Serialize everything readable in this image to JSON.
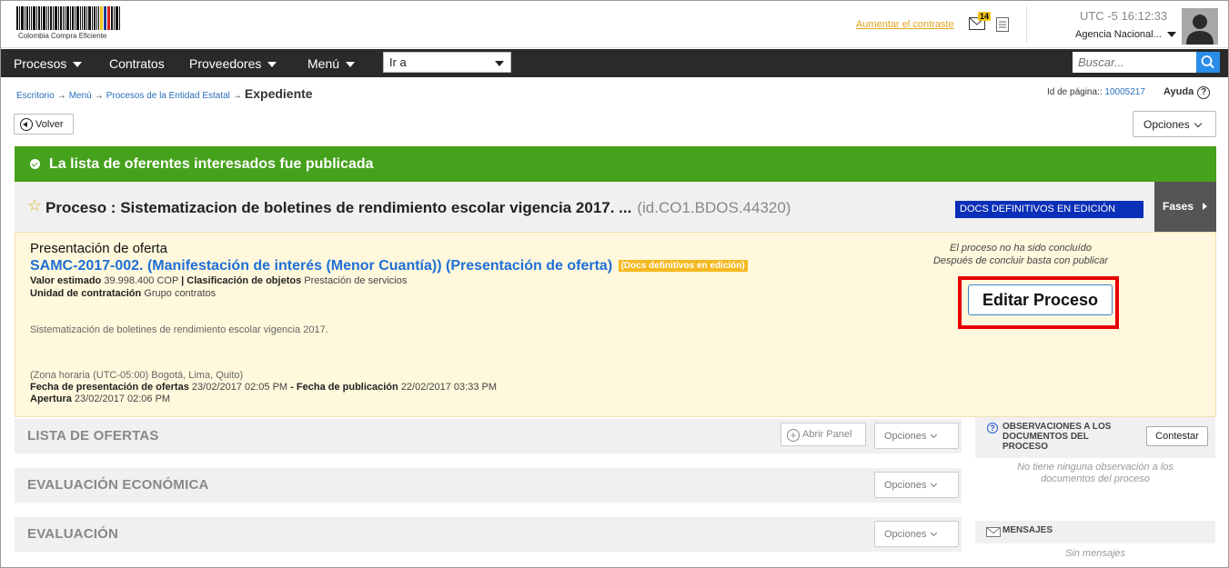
{
  "header": {
    "logo_text": "Colombia Compra Eficiente",
    "contrast_link": "Aumentar el contraste",
    "mail_count": "14",
    "timezone": "UTC -5",
    "time": "16:12:33",
    "agency": "Agencia Nacional..."
  },
  "nav": {
    "items": [
      "Procesos",
      "Contratos",
      "Proveedores",
      "Menú"
    ],
    "goto_value": "Ir a",
    "search_placeholder": "Buscar..."
  },
  "breadcrumb": {
    "items": [
      "Escritorio",
      "Menú",
      "Procesos de la Entidad Estatal"
    ],
    "current": "Expediente",
    "page_id_label": "Id de página::",
    "page_id": "10005217",
    "help": "Ayuda"
  },
  "toolbar": {
    "back_label": "Volver",
    "options_label": "Opciones"
  },
  "banner": {
    "message": "La lista de oferentes interesados fue publicada"
  },
  "process": {
    "title": "Proceso : Sistematizacion de boletines de rendimiento escolar vigencia 2017. ...",
    "id": "(id.CO1.BDOS.44320)",
    "status_badge": "DOCS DEFINITIVOS EN EDICIÓN",
    "phases_label": "Fases"
  },
  "info": {
    "section": "Presentación de oferta",
    "link": "SAMC-2017-002. (Manifestación de interés (Menor Cuantía)) (Presentación de oferta)",
    "link_badge": "(Docs definitivos en edición)",
    "valor_label": "Valor estimado",
    "valor": "39.998.400 COP",
    "clasif_label": "| Clasificación de objetos",
    "clasif": "Prestación de servicios",
    "unidad_label": "Unidad de contratación",
    "unidad": "Grupo contratos",
    "description": "Sistematización de boletines de rendimiento escolar vigencia 2017.",
    "timezone": "(Zona horaria (UTC-05:00) Bogotá, Lima, Quito)",
    "fecha_oferta_label": "Fecha de presentación de ofertas",
    "fecha_oferta": "23/02/2017 02:05 PM",
    "fecha_pub_label": "- Fecha de publicación",
    "fecha_pub": "22/02/2017 03:33 PM",
    "apertura_label": "Apertura",
    "apertura": "23/02/2017 02:06 PM",
    "notice_line1": "El proceso no ha sido concluído",
    "notice_line2": "Después de concluir basta con publicar",
    "edit_button": "Editar Proceso"
  },
  "sections": [
    {
      "title": "LISTA DE OFERTAS",
      "options": "Opciones",
      "panel": "Abrir Panel"
    },
    {
      "title": "EVALUACIÓN ECONÓMICA",
      "options": "Opciones"
    },
    {
      "title": "EVALUACIÓN",
      "options": "Opciones"
    }
  ],
  "sidebar": {
    "obs_title": "OBSERVACIONES A LOS DOCUMENTOS DEL PROCESO",
    "obs_reply": "Contestar",
    "obs_empty": "No tiene ninguna observación a los documentos del proceso",
    "msgs_title": "MENSAJES",
    "msgs_empty": "Sin mensajes"
  },
  "colors": {
    "banner_green": "#46a11c",
    "badge_blue": "#0a2fb8",
    "link_blue": "#1f6fd6",
    "highlight_red": "#e60000",
    "nav_dark": "#2a2a2a"
  }
}
